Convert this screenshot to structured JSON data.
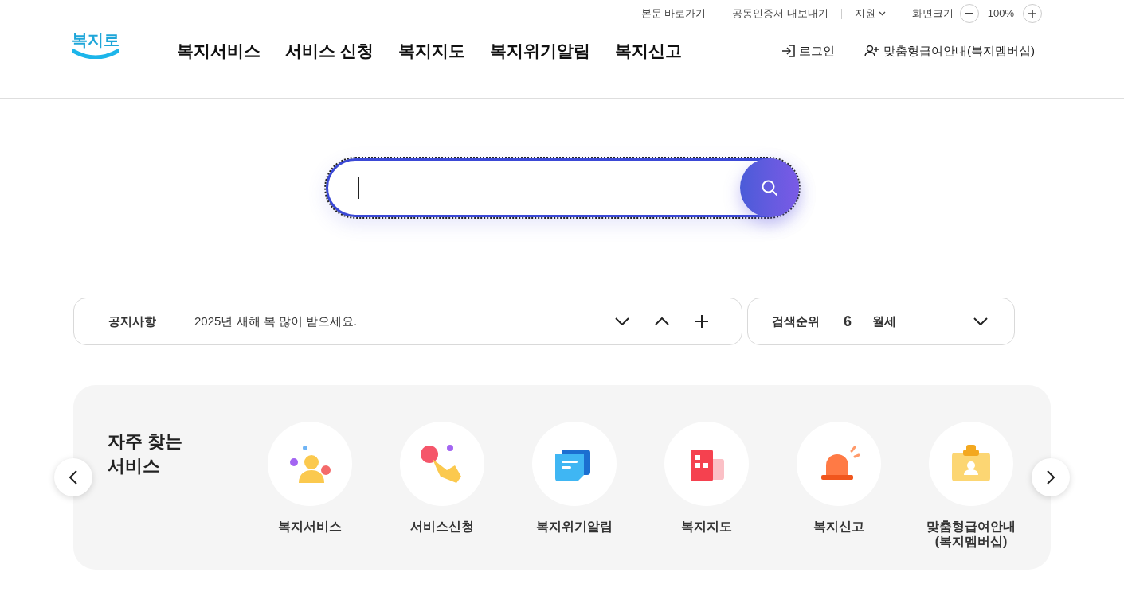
{
  "utility_links": [
    {
      "label": "본문 바로가기",
      "kind": "link"
    },
    {
      "label": "공동인증서 내보내기",
      "kind": "link"
    },
    {
      "label": "지원",
      "kind": "dropdown"
    }
  ],
  "screen_size": {
    "label": "화면크기",
    "value": "100%"
  },
  "logo": "복지로",
  "nav": [
    "복지서비스",
    "서비스 신청",
    "복지지도",
    "복지위기알림",
    "복지신고"
  ],
  "user_links": [
    {
      "label": "로그인",
      "kind": "login"
    },
    {
      "label": "맞춤형급여안내(복지멤버십)",
      "kind": "membership"
    }
  ],
  "notice": {
    "label": "공지사항",
    "text": "2025년 새해 복 많이 받으세요."
  },
  "search_rank": {
    "label": "검색순위",
    "rank": "6",
    "term": "월세"
  },
  "services": {
    "title": "자주 찾는\n서비스",
    "items": [
      {
        "label": "복지서비스",
        "kind": "person"
      },
      {
        "label": "서비스신청",
        "kind": "hand"
      },
      {
        "label": "복지위기알림",
        "kind": "message"
      },
      {
        "label": "복지지도",
        "kind": "map"
      },
      {
        "label": "복지신고",
        "kind": "siren"
      },
      {
        "label": "맞춤형급여안내\n(복지멤버십)",
        "kind": "card"
      }
    ]
  }
}
